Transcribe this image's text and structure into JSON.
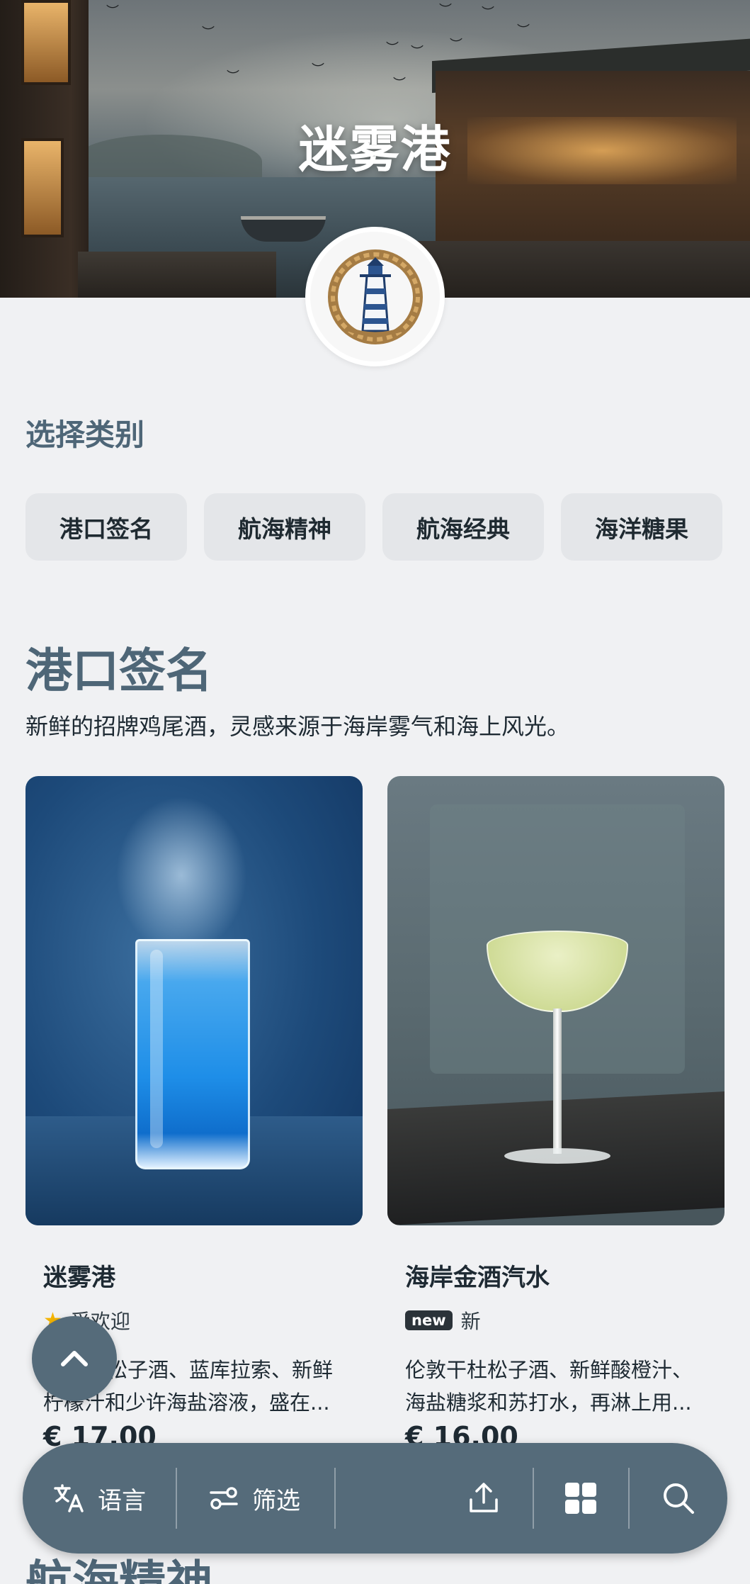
{
  "hero": {
    "title": "迷雾港",
    "logo_icon": "lighthouse-rope-logo"
  },
  "category_section": {
    "label": "选择类别",
    "chips": [
      "港口签名",
      "航海精神",
      "航海经典",
      "海洋糖果"
    ]
  },
  "current_section": {
    "title": "港口签名",
    "description": "新鲜的招牌鸡尾酒，灵感来源于海岸雾气和海上风光。"
  },
  "products": [
    {
      "name": "迷雾港",
      "badge_icon": "star-icon",
      "badge_text": "受欢迎",
      "description_line1": "松子酒、蓝库拉索、新鲜",
      "description_line2": "柠檬汁和少许海盐溶液，盛在...",
      "price": "€ 17.00"
    },
    {
      "name": "海岸金酒汽水",
      "badge_tag": "new",
      "badge_text": "新",
      "description_line1": "伦敦干杜松子酒、新鲜酸橙汁、",
      "description_line2": "海盐糖浆和苏打水，再淋上用...",
      "price": "€ 16.00"
    }
  ],
  "next_section": {
    "title": "航海精神"
  },
  "toolbar": {
    "language_label": "语言",
    "filter_label": "筛选",
    "icons": [
      "translate-icon",
      "filter-icon",
      "share-icon",
      "grid-icon",
      "search-icon"
    ]
  },
  "colors": {
    "accent": "#556b7a",
    "heading": "#4e6677",
    "background": "#f0f1f3",
    "chip": "#e4e6e9"
  }
}
